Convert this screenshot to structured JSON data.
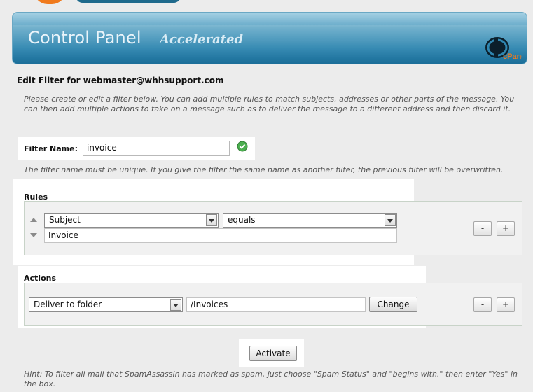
{
  "header": {
    "title": "Control Panel",
    "subtitle": "Accelerated",
    "logo_text": "cPanel",
    "colors": {
      "banner_top": "#a6d1e4",
      "banner_bottom": "#1c6f9a",
      "accent_orange": "#f07a1d"
    }
  },
  "page": {
    "heading": "Edit Filter for webmaster@whhsupport.com",
    "intro": "Please create or edit a filter below. You can add multiple rules to match subjects, addresses or other parts of the message. You can then add multiple actions to take on a message such as to deliver the message to a different address and then discard it."
  },
  "filter": {
    "label": "Filter Name:",
    "value": "invoice",
    "status_icon": "check-circle-icon",
    "unique_note": "The filter name must be unique. If you give the filter the same name as another filter, the previous filter will be overwritten."
  },
  "rules": {
    "title": "Rules",
    "items": [
      {
        "field": "Subject",
        "operator": "equals",
        "value": "Invoice"
      }
    ],
    "remove_label": "-",
    "add_label": "+"
  },
  "actions": {
    "title": "Actions",
    "items": [
      {
        "action": "Deliver to folder",
        "destination": "/Invoices",
        "change_label": "Change"
      }
    ],
    "remove_label": "-",
    "add_label": "+"
  },
  "activate_label": "Activate",
  "hint": "Hint: To filter all mail that SpamAssassin has marked as spam, just choose \"Spam Status\" and \"begins with,\" then enter \"Yes\" in the box."
}
